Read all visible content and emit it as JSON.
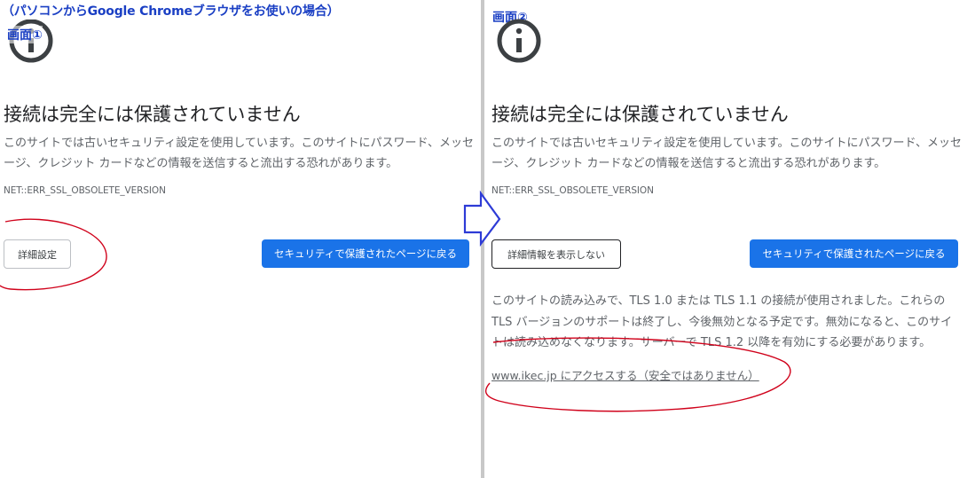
{
  "caption": "（パソコンからGoogle Chromeブラウザをお使いの場合）",
  "colors": {
    "caption_blue": "#1a3fc4",
    "primary_button": "#1a73e8",
    "annotation_red": "#d0021b",
    "arrow_blue": "#2d3bd6"
  },
  "left_screen": {
    "label": "画面①",
    "icon": "info-icon",
    "heading": "接続は完全には保護されていません",
    "body": "このサイトでは古いセキュリティ設定を使用しています。このサイトにパスワード、メッセージ、クレジット カードなどの情報を送信すると流出する恐れがあります。",
    "error_code": "NET::ERR_SSL_OBSOLETE_VERSION",
    "details_button": "詳細設定",
    "back_button": "セキュリティで保護されたページに戻る"
  },
  "right_screen": {
    "label": "画面②",
    "icon": "info-icon",
    "heading": "接続は完全には保護されていません",
    "body": "このサイトでは古いセキュリティ設定を使用しています。このサイトにパスワード、メッセージ、クレジット カードなどの情報を送信すると流出する恐れがあります。",
    "error_code": "NET::ERR_SSL_OBSOLETE_VERSION",
    "hide_details_button": "詳細情報を表示しない",
    "back_button": "セキュリティで保護されたページに戻る",
    "details_text": "このサイトの読み込みで、TLS 1.0 または TLS 1.1 の接続が使用されました。これらの TLS バージョンのサポートは終了し、今後無効となる予定です。無効になると、このサイトは読み込めなくなります。サーバーで TLS 1.2 以降を有効にする必要があります。",
    "proceed_link": "www.ikec.jp にアクセスする（安全ではありません）"
  }
}
